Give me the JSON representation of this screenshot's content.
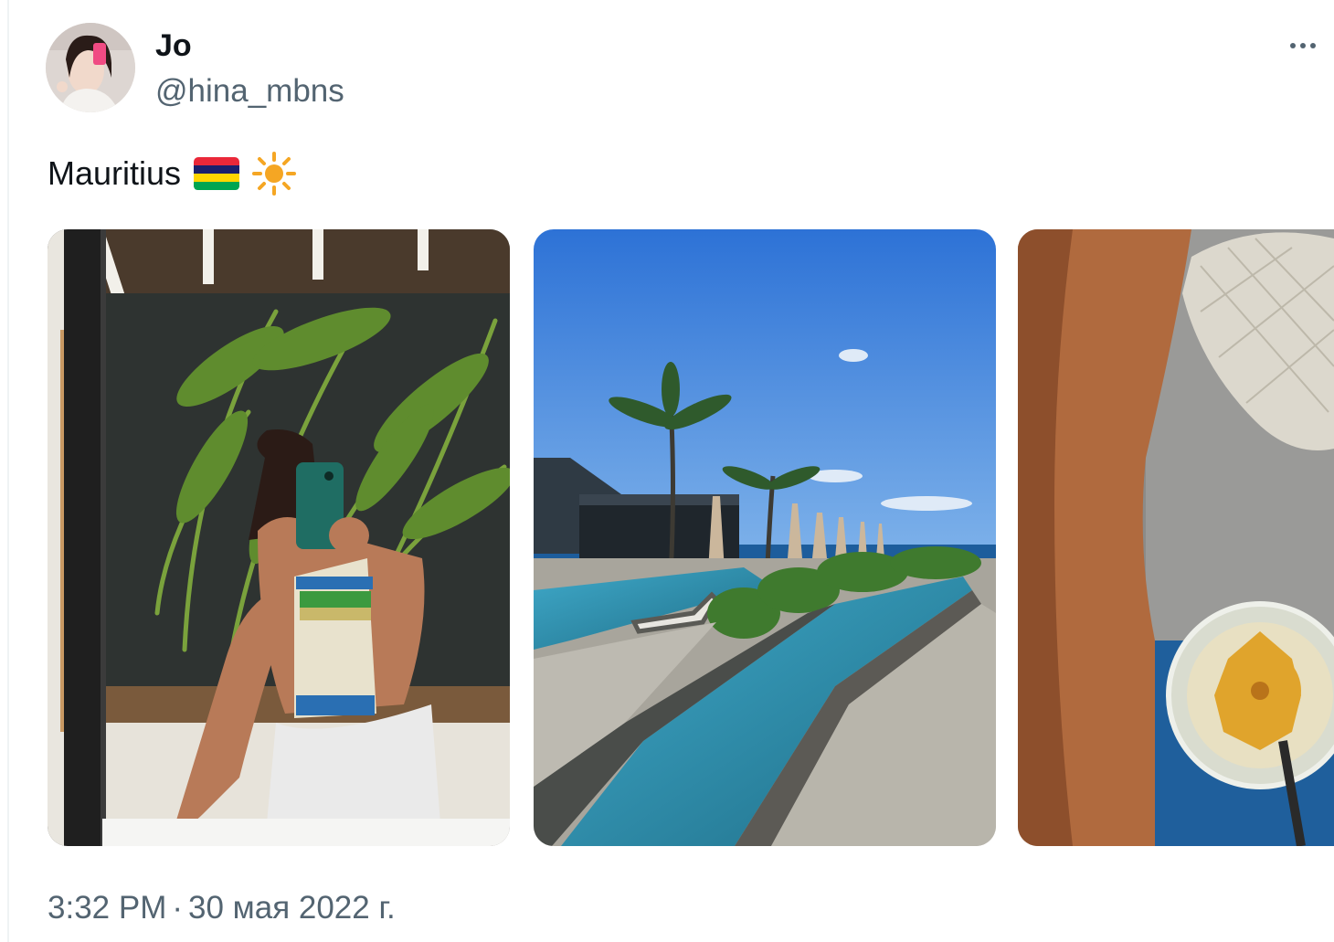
{
  "author": {
    "display_name": "Jo",
    "handle": "@hina_mbns"
  },
  "tweet": {
    "text": "Mauritius",
    "emojis": [
      "mauritius-flag-icon",
      "sun-icon"
    ]
  },
  "media": [
    {
      "alt": "mirror-selfie-photo"
    },
    {
      "alt": "resort-pool-photo"
    },
    {
      "alt": "leg-and-drink-photo"
    }
  ],
  "meta": {
    "time": "3:32 PM",
    "separator": "·",
    "date": "30 мая 2022 г."
  },
  "colors": {
    "text_primary": "#0f1419",
    "text_secondary": "#536471",
    "flag": [
      "#ea2839",
      "#1a206d",
      "#ffd500",
      "#00a551"
    ],
    "sun": "#f5a623"
  }
}
